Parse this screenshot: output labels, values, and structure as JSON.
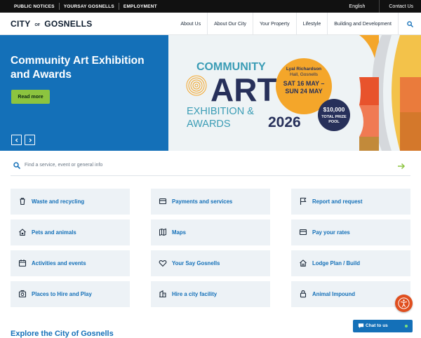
{
  "utility_bar": {
    "links": [
      "PUBLIC NOTICES",
      "YOURSAY GOSNELLS",
      "EMPLOYMENT"
    ],
    "language": "English",
    "contact": "Contact Us"
  },
  "logo": {
    "word1": "CITY",
    "word2": "OF",
    "word3": "GOSNELLS"
  },
  "nav": {
    "items": [
      "About Us",
      "About Our City",
      "Your Property",
      "Lifestyle",
      "Building and Development"
    ]
  },
  "hero": {
    "title": "Community Art Exhibition and Awards",
    "button": "Read more",
    "banner": {
      "line1": "COMMUNITY",
      "line2": "ART",
      "line3": "EXHIBITION &",
      "line4": "AWARDS",
      "year": "2026",
      "venue1": "Lyal Richardson",
      "venue2": "Hall, Gosnells",
      "date1": "SAT 16 MAY –",
      "date2": "SUN 24 MAY",
      "prize1": "$10,000",
      "prize2": "TOTAL PRIZE",
      "prize3": "POOL"
    }
  },
  "search": {
    "placeholder": "Find a service, event or general info"
  },
  "tiles": [
    [
      "Waste and recycling",
      "Payments and services",
      "Report and request"
    ],
    [
      "Pets and animals",
      "Maps",
      "Pay your rates"
    ],
    [
      "Activities and events",
      "Your Say Gosnells",
      "Lodge Plan / Build"
    ],
    [
      "Places to Hire and Play",
      "Hire a city facility",
      "Animal Impound"
    ]
  ],
  "explore_heading": "Explore the City of Gosnells",
  "chat": {
    "label": "Chat to us"
  },
  "colors": {
    "brand_blue": "#1470b8",
    "accent_green": "#8cc43f",
    "accessibility_orange": "#e04f1f"
  }
}
